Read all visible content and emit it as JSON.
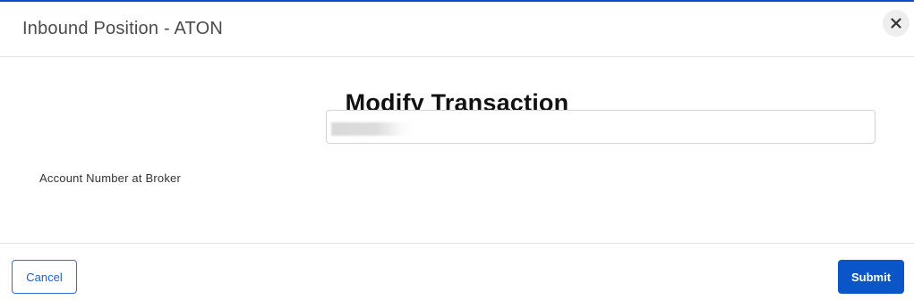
{
  "header": {
    "title": "Inbound Position - ATON",
    "close_icon": "close-icon"
  },
  "body": {
    "heading": "Modify Transaction",
    "fields": [
      {
        "label": "Account Number at Broker",
        "value": "",
        "value_redacted": true
      }
    ]
  },
  "footer": {
    "cancel_label": "Cancel",
    "submit_label": "Submit"
  },
  "colors": {
    "accent": "#0a55c8",
    "top_border": "#0a4fc4",
    "divider": "#e3e3e3"
  }
}
